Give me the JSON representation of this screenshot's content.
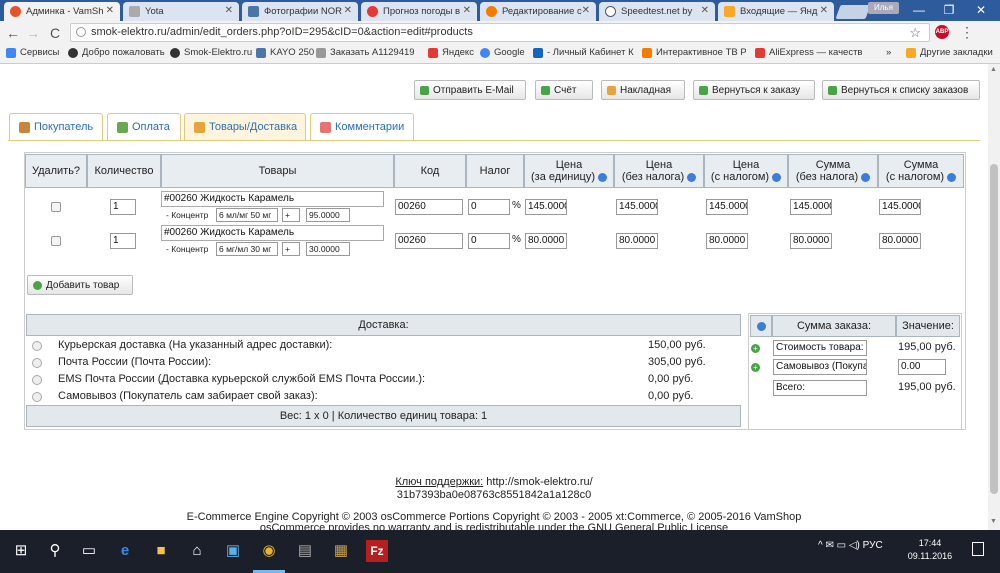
{
  "browser": {
    "tabs": [
      {
        "title": "Админка - VamSh",
        "active": true,
        "color": "#e5532d"
      },
      {
        "title": "Yota",
        "active": false,
        "color": "#aaaaaa"
      },
      {
        "title": "Фотографии NOR",
        "active": false,
        "color": "#4a76a8"
      },
      {
        "title": "Прогноз погоды в",
        "active": false,
        "color": "#e53935"
      },
      {
        "title": "Редактирование с",
        "active": false,
        "color": "#f57c00"
      },
      {
        "title": "Speedtest.net by",
        "active": false,
        "color": "#555555"
      },
      {
        "title": "Входящие — Янд",
        "active": false,
        "color": "#f9a825"
      }
    ],
    "user_badge": "Илья",
    "window": {
      "minimize": "—",
      "maximize": "❐",
      "close": "✕"
    },
    "nav": {
      "back": "←",
      "forward": "→",
      "reload": "C"
    },
    "url": "smok-elektro.ru/admin/edit_orders.php?oID=295&cID=0&action=edit#products",
    "abp": "ABP",
    "bookmarks": [
      {
        "label": "Сервисы",
        "color": "#4285f4"
      },
      {
        "label": "Добро пожаловать",
        "color": "#333333"
      },
      {
        "label": "Smok-Elektro.ru",
        "color": "#333333"
      },
      {
        "label": "KAYO 250",
        "color": "#4a76a8"
      },
      {
        "label": "Заказать A11294192",
        "color": "#999999"
      },
      {
        "label": "Яндекс",
        "color": "#e53935"
      },
      {
        "label": "Google",
        "color": "#4285f4"
      },
      {
        "label": "- Личный Кабинет К",
        "color": "#1565c0"
      },
      {
        "label": "Интерактивное ТВ Р",
        "color": "#f57c00"
      },
      {
        "label": "AliExpress — качеств",
        "color": "#e53935"
      },
      {
        "label": "»",
        "color": "#f2f2f2"
      },
      {
        "label": "Другие закладки",
        "color": "#f9a825"
      }
    ]
  },
  "actions": [
    {
      "label": "Отправить E-Mail",
      "color": "#47a447"
    },
    {
      "label": "Счёт",
      "color": "#47a447"
    },
    {
      "label": "Накладная",
      "color": "#e8a33d"
    },
    {
      "label": "Вернуться к заказу",
      "color": "#47a447"
    },
    {
      "label": "Вернуться к списку заказов",
      "color": "#47a447"
    }
  ],
  "page_tabs": [
    {
      "label": "Покупатель",
      "color": "#c9853b"
    },
    {
      "label": "Оплата",
      "color": "#6aa84f"
    },
    {
      "label": "Товары/Доставка",
      "color": "#e8a33d",
      "active": true
    },
    {
      "label": "Комментарии",
      "color": "#e57373"
    }
  ],
  "products_table": {
    "headers": {
      "delete": "Удалить?",
      "qty": "Количество",
      "products": "Товары",
      "code": "Код",
      "tax": "Налог",
      "price_unit_1": "Цена",
      "price_unit_2": "(за единицу)",
      "price_notax_1": "Цена",
      "price_notax_2": "(без налога)",
      "price_tax_1": "Цена",
      "price_tax_2": "(с налогом)",
      "sum_notax_1": "Сумма",
      "sum_notax_2": "(без налога)",
      "sum_tax_1": "Сумма",
      "sum_tax_2": "(с налогом)"
    },
    "rows": [
      {
        "qty": "1",
        "name": "#00260 Жидкость Карамель",
        "attr_label": "- Концентр",
        "attr_value": "6 мл/мг 50 мг",
        "attr_prefix": "+",
        "attr_price": "95.0000",
        "code": "00260",
        "tax": "0",
        "pct": "%",
        "price_unit": "145.0000",
        "price_notax": "145.0000",
        "price_tax": "145.0000",
        "sum_notax": "145.0000",
        "sum_tax": "145.0000"
      },
      {
        "qty": "1",
        "name": "#00260 Жидкость Карамель",
        "attr_label": "- Концентр",
        "attr_value": "6 мг/мл 30 мг",
        "attr_prefix": "+",
        "attr_price": "30.0000",
        "code": "00260",
        "tax": "0",
        "pct": "%",
        "price_unit": "80.0000",
        "price_notax": "80.0000",
        "price_tax": "80.0000",
        "sum_notax": "80.0000",
        "sum_tax": "80.0000"
      }
    ],
    "add_button": "Добавить товар"
  },
  "delivery": {
    "header": "Доставка:",
    "options": [
      {
        "label": "Курьерская доставка (На указанный адрес доставки):",
        "price": "150,00 руб."
      },
      {
        "label": "Почта России (Почта России):",
        "price": "305,00 руб."
      },
      {
        "label": "EMS Почта России (Доставка курьерской службой EMS Почта России.):",
        "price": "0,00 руб."
      },
      {
        "label": "Самовывоз (Покупатель сам забирает свой заказ):",
        "price": "0,00 руб."
      }
    ],
    "footer": "Вес: 1 x 0 | Количество единиц товара: 1"
  },
  "order_sum": {
    "header_sum": "Сумма заказа:",
    "header_value": "Значение:",
    "rows": [
      {
        "label": "Стоимость товара:",
        "value": "195,00 руб."
      },
      {
        "label": "Самовывоз (Покупатель",
        "value": "0.00"
      },
      {
        "label": "Всего:",
        "value": "195,00 руб."
      }
    ]
  },
  "footer": {
    "support_label": "Ключ поддержки:",
    "support_url": " http://smok-elektro.ru/",
    "key": "31b7393ba0e08763c8551842a1a128c0",
    "copyright": "E-Commerce Engine Copyright © 2003 osCommerce Portions Copyright © 2003 - 2005 xt:Commerce, © 2005-2016 VamShop",
    "warranty": "osCommerce provides no warranty and is redistributable under the GNU General Public License"
  },
  "taskbar": {
    "tray": "^ ✉ ▭ ◁) РУС",
    "time": "17:44",
    "date": "09.11.2016"
  }
}
